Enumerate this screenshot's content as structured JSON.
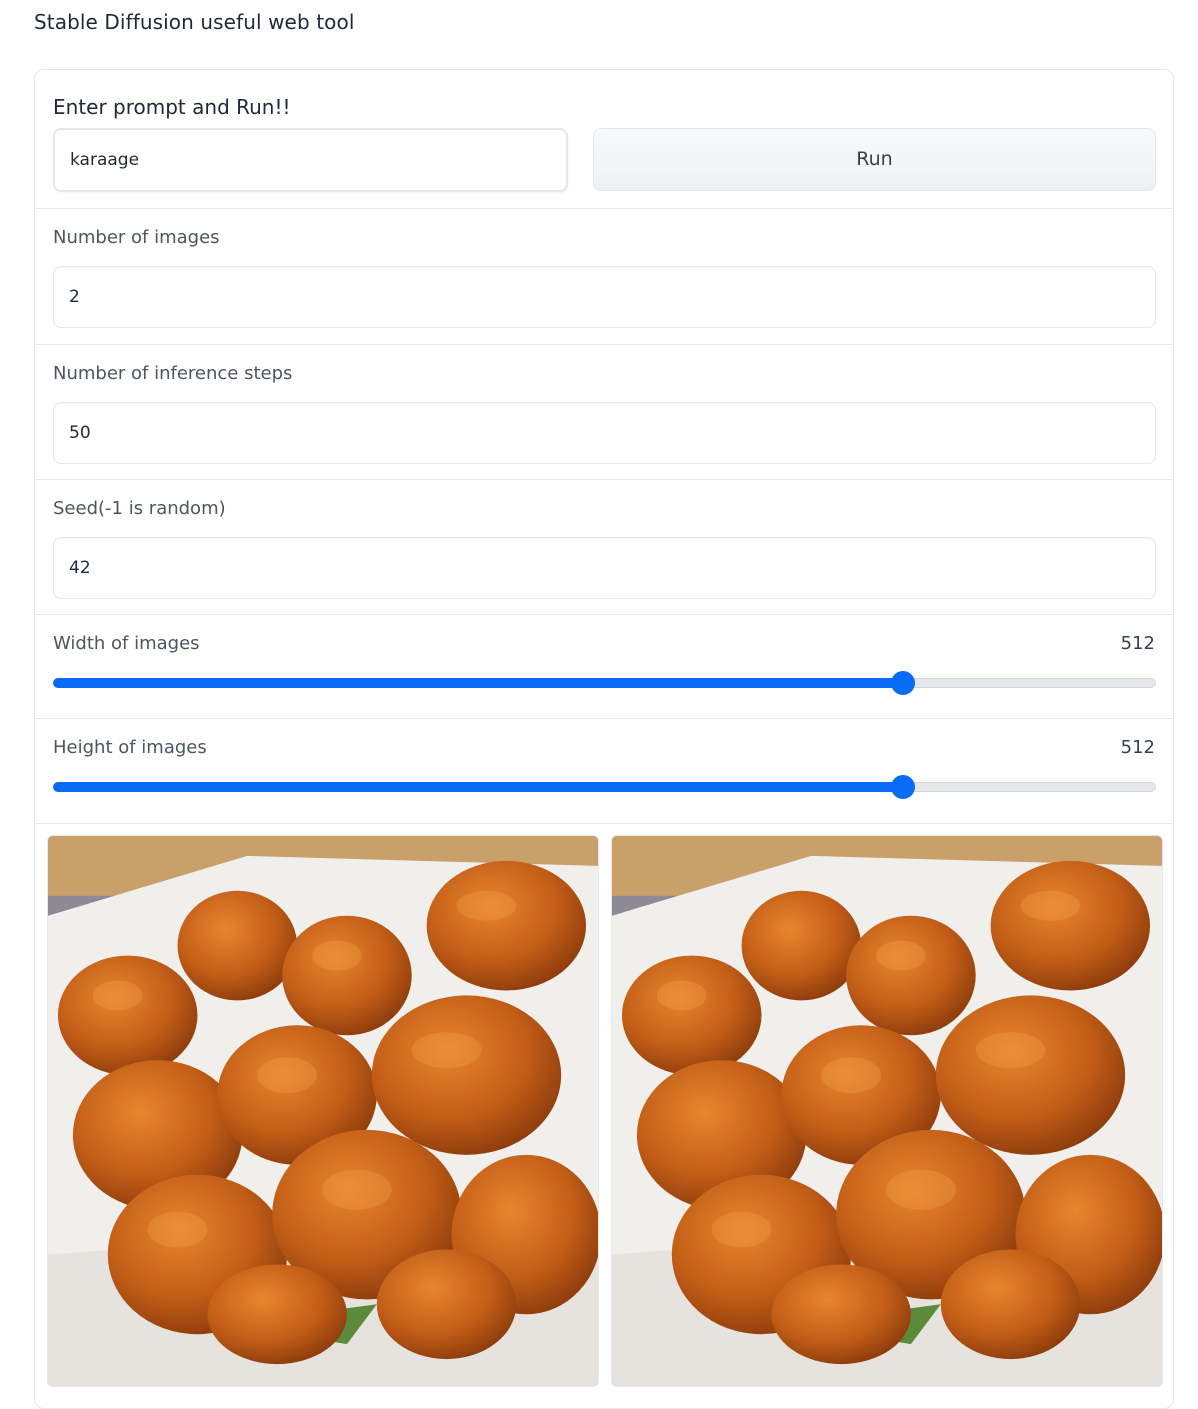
{
  "app": {
    "title": "Stable Diffusion useful web tool"
  },
  "prompt": {
    "label": "Enter prompt and Run!!",
    "value": "karaage",
    "run_label": "Run"
  },
  "num_images": {
    "label": "Number of images",
    "value": "2"
  },
  "steps": {
    "label": "Number of inference steps",
    "value": "50"
  },
  "seed": {
    "label": "Seed(-1 is random)",
    "value": "42"
  },
  "width": {
    "label": "Width of images",
    "value": "512",
    "fraction": 0.771
  },
  "height": {
    "label": "Height of images",
    "value": "512",
    "fraction": 0.771
  },
  "gallery": {
    "count": 2,
    "subject": "karaage (Japanese fried chicken) in a paper-lined tray"
  },
  "colors": {
    "accent": "#0a6cf5",
    "border": "#e5e7eb",
    "chicken": "#c5621a"
  }
}
